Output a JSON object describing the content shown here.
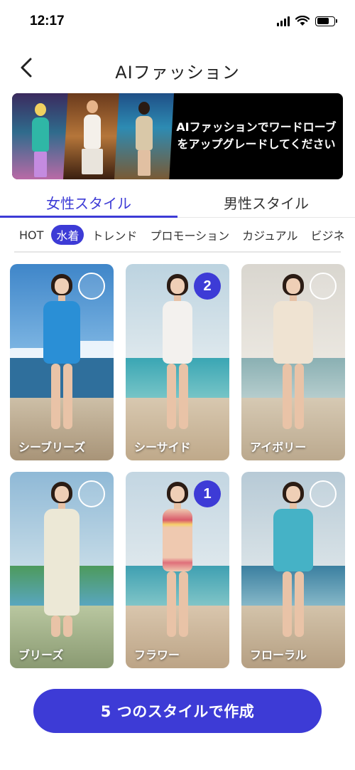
{
  "status_bar": {
    "time": "12:17"
  },
  "header": {
    "title": "AIファッション",
    "back_icon": "chevron-left-icon"
  },
  "banner": {
    "line1": "AIファッションでワードローブ",
    "line2": "をアップグレードしてください"
  },
  "gender_tabs": [
    {
      "label": "女性スタイル",
      "active": true
    },
    {
      "label": "男性スタイル",
      "active": false
    }
  ],
  "categories": [
    {
      "label": "HOT",
      "active": false
    },
    {
      "label": "水着",
      "active": true
    },
    {
      "label": "トレンド",
      "active": false
    },
    {
      "label": "プロモーション",
      "active": false
    },
    {
      "label": "カジュアル",
      "active": false
    },
    {
      "label": "ビジネ",
      "active": false
    }
  ],
  "styles": [
    {
      "label": "シーブリーズ",
      "selected_order": ""
    },
    {
      "label": "シーサイド",
      "selected_order": "2"
    },
    {
      "label": "アイボリー",
      "selected_order": ""
    },
    {
      "label": "ブリーズ",
      "selected_order": ""
    },
    {
      "label": "フラワー",
      "selected_order": "1"
    },
    {
      "label": "フローラル",
      "selected_order": ""
    }
  ],
  "cta": {
    "label": "5 つのスタイルで作成"
  },
  "colors": {
    "accent": "#3d3bd6"
  }
}
